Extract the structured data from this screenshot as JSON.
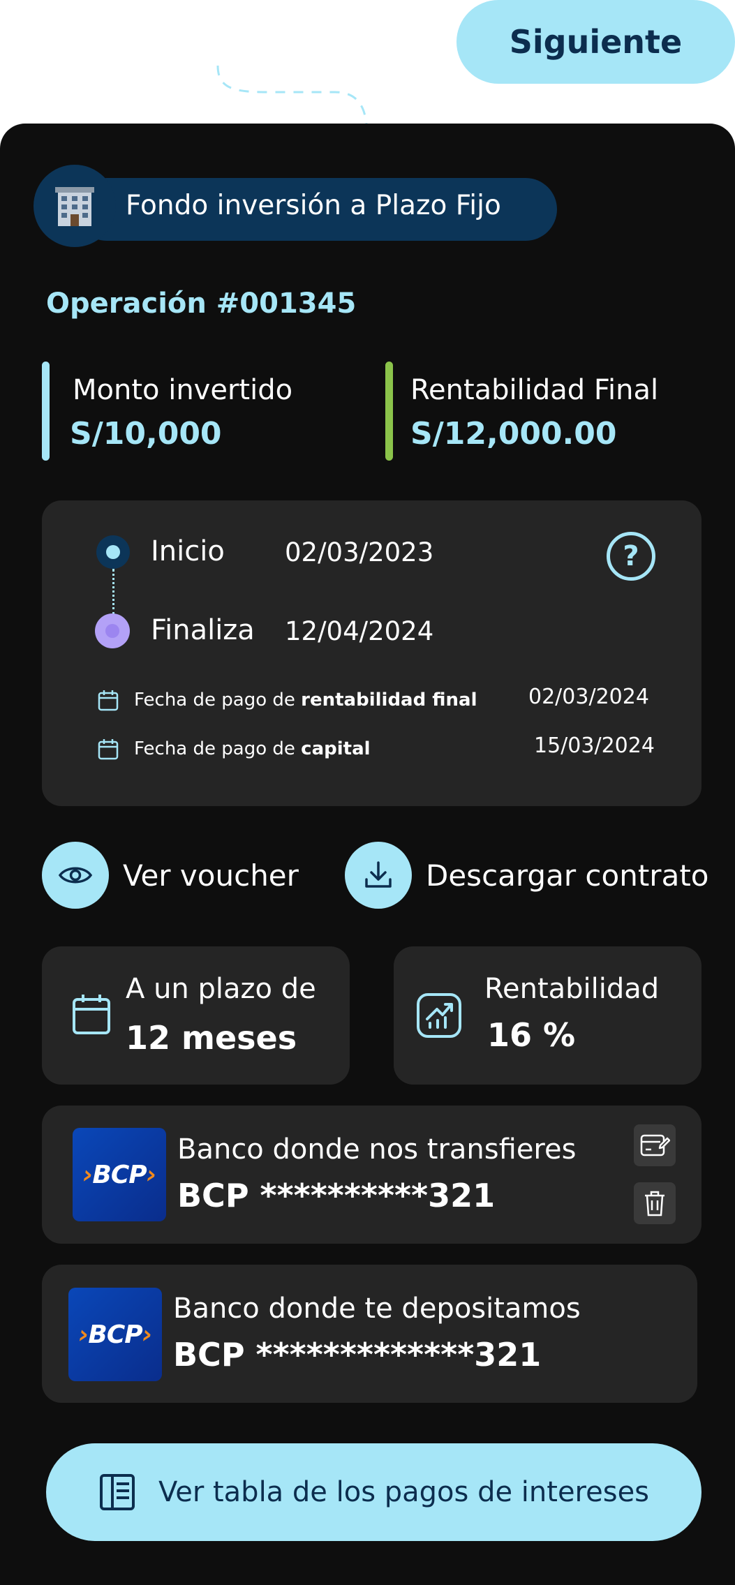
{
  "header": {
    "next_label": "Siguiente"
  },
  "fund": {
    "name": "Fondo inversión a Plazo Fijo",
    "icon": "building-icon"
  },
  "operation": {
    "label": "Operación #001345"
  },
  "stats": {
    "invested": {
      "title": "Monto invertido",
      "value": "S/10,000",
      "bar_color": "#a6e6f7"
    },
    "final": {
      "title": "Rentabilidad Final",
      "value": "S/12,000.00",
      "bar_color": "#8bc34a"
    }
  },
  "dates": {
    "start_label": "Inicio",
    "start_value": "02/03/2023",
    "end_label": "Finaliza",
    "end_value": "12/04/2024",
    "payments": [
      {
        "prefix": "Fecha de pago de ",
        "bold": "rentabilidad final",
        "date": "02/03/2024"
      },
      {
        "prefix": "Fecha de pago de ",
        "bold": "capital",
        "date": "15/03/2024"
      }
    ]
  },
  "actions": {
    "voucher_label": "Ver voucher",
    "contract_label": "Descargar contrato"
  },
  "term": {
    "label": "A un plazo de",
    "value": "12 meses"
  },
  "rate": {
    "label": "Rentabilidad",
    "value": "16 %"
  },
  "banks": {
    "transfer": {
      "label": "Banco donde nos transfieres",
      "account": "BCP **********321",
      "logo": "BCP"
    },
    "deposit": {
      "label": "Banco donde te depositamos",
      "account": "BCP *************321",
      "logo": "BCP"
    }
  },
  "footer": {
    "table_label": "Ver tabla de los pagos de intereses"
  }
}
